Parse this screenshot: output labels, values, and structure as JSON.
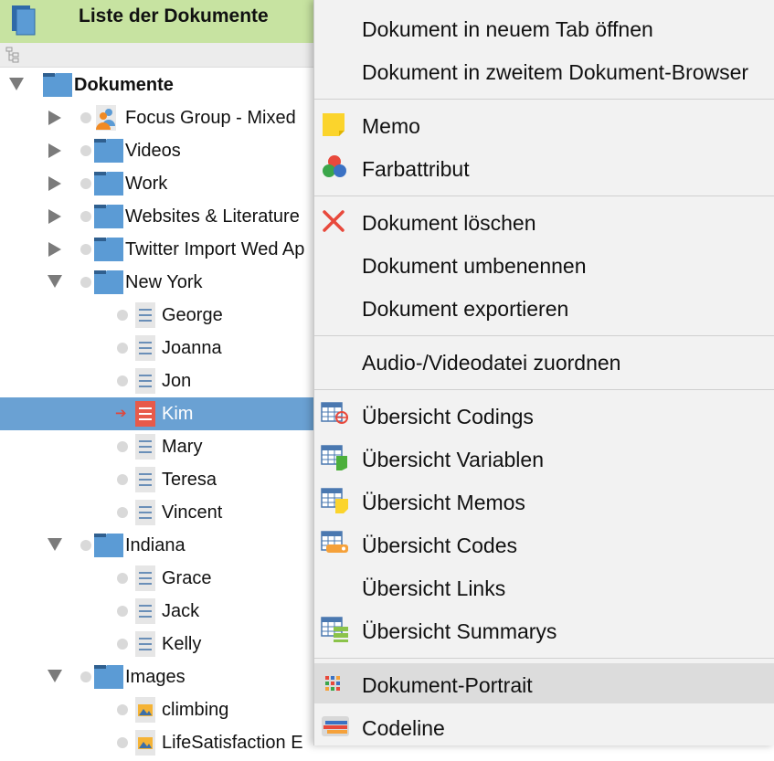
{
  "panel": {
    "title": "Liste der Dokumente",
    "tree": [
      {
        "label": "Dokumente",
        "level": 0,
        "expanded": true,
        "type": "folder",
        "bold": true
      },
      {
        "label": "Focus Group - Mixed",
        "level": 1,
        "expanded": false,
        "type": "focus-group"
      },
      {
        "label": "Videos",
        "level": 1,
        "expanded": false,
        "type": "folder"
      },
      {
        "label": "Work",
        "level": 1,
        "expanded": false,
        "type": "folder"
      },
      {
        "label": "Websites & Literature",
        "level": 1,
        "expanded": false,
        "type": "folder"
      },
      {
        "label": "Twitter Import Wed Ap",
        "level": 1,
        "expanded": false,
        "type": "folder"
      },
      {
        "label": "New York",
        "level": 1,
        "expanded": true,
        "type": "folder"
      },
      {
        "label": "George",
        "level": 2,
        "type": "text"
      },
      {
        "label": "Joanna",
        "level": 2,
        "type": "text"
      },
      {
        "label": "Jon",
        "level": 2,
        "type": "text"
      },
      {
        "label": "Kim",
        "level": 2,
        "type": "text",
        "selected": true
      },
      {
        "label": "Mary",
        "level": 2,
        "type": "text"
      },
      {
        "label": "Teresa",
        "level": 2,
        "type": "text"
      },
      {
        "label": "Vincent",
        "level": 2,
        "type": "text"
      },
      {
        "label": "Indiana",
        "level": 1,
        "expanded": true,
        "type": "folder"
      },
      {
        "label": "Grace",
        "level": 2,
        "type": "text"
      },
      {
        "label": "Jack",
        "level": 2,
        "type": "text"
      },
      {
        "label": "Kelly",
        "level": 2,
        "type": "text"
      },
      {
        "label": "Images",
        "level": 1,
        "expanded": true,
        "type": "folder"
      },
      {
        "label": "climbing",
        "level": 2,
        "type": "image"
      },
      {
        "label": "LifeSatisfaction E",
        "level": 2,
        "type": "image"
      }
    ]
  },
  "menu": {
    "items": [
      {
        "label": "Dokument in neuem Tab öffnen",
        "icon": ""
      },
      {
        "label": "Dokument in zweitem Dokument-Browser",
        "icon": ""
      },
      {
        "sep": true
      },
      {
        "label": "Memo",
        "icon": "memo-icon"
      },
      {
        "label": "Farbattribut",
        "icon": "color-attribute-icon"
      },
      {
        "sep": true
      },
      {
        "label": "Dokument löschen",
        "icon": "delete-icon"
      },
      {
        "label": "Dokument umbenennen",
        "icon": ""
      },
      {
        "label": "Dokument exportieren",
        "icon": ""
      },
      {
        "sep": true
      },
      {
        "label": "Audio-/Videodatei zuordnen",
        "icon": ""
      },
      {
        "sep": true
      },
      {
        "label": "Übersicht Codings",
        "icon": "overview-codings-icon"
      },
      {
        "label": "Übersicht Variablen",
        "icon": "overview-variables-icon"
      },
      {
        "label": "Übersicht Memos",
        "icon": "overview-memos-icon"
      },
      {
        "label": "Übersicht Codes",
        "icon": "overview-codes-icon"
      },
      {
        "label": "Übersicht Links",
        "icon": ""
      },
      {
        "label": "Übersicht Summarys",
        "icon": "overview-summaries-icon"
      },
      {
        "sep": true
      },
      {
        "label": "Dokument-Portrait",
        "icon": "document-portrait-icon",
        "highlighted": true
      },
      {
        "label": "Codeline",
        "icon": "codeline-icon"
      }
    ]
  },
  "colors": {
    "header_bg": "#c7e3a1",
    "selection_bg": "#6aa1d3",
    "folder_blue": "#5b9bd5",
    "menu_bg": "#f2f2f2",
    "menu_highlight": "#dcdcdc"
  }
}
